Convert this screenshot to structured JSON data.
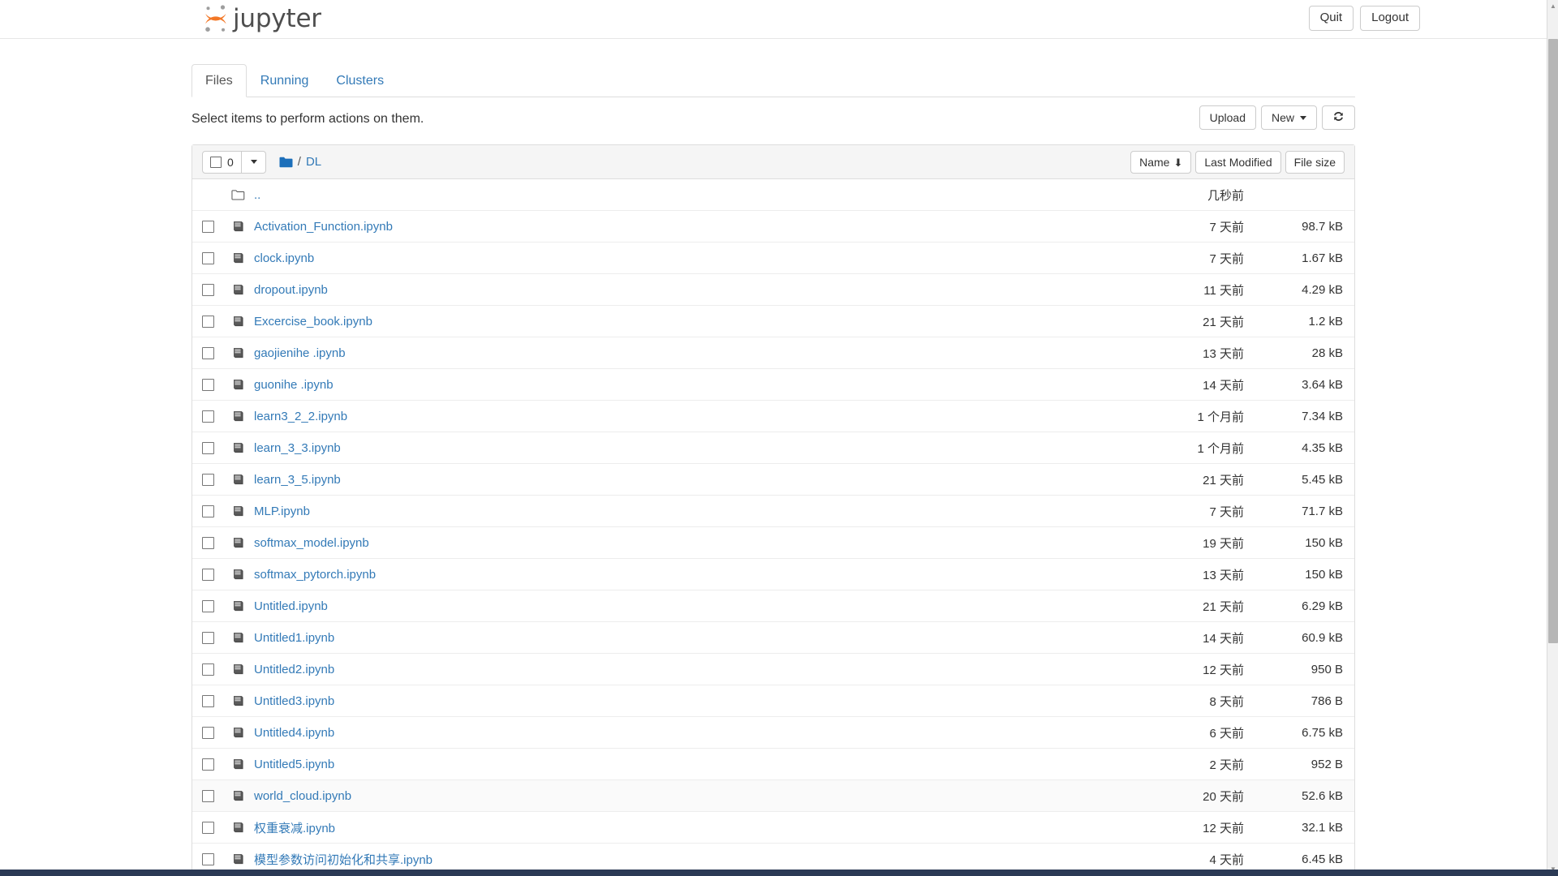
{
  "header": {
    "logo_text": "jupyter",
    "logo_icon": "jupyter-logo-icon",
    "quit_label": "Quit",
    "logout_label": "Logout"
  },
  "tabs": [
    {
      "label": "Files",
      "active": true
    },
    {
      "label": "Running",
      "active": false
    },
    {
      "label": "Clusters",
      "active": false
    }
  ],
  "actions": {
    "note": "Select items to perform actions on them.",
    "upload_label": "Upload",
    "new_label": "New",
    "refresh_icon": "refresh-icon"
  },
  "list_toolbar": {
    "selected_count": "0",
    "folder_icon": "folder-icon",
    "breadcrumb_separator": "/",
    "breadcrumb_current": "DL",
    "sort_name": "Name",
    "sort_name_arrow": "⬇",
    "sort_last_modified": "Last Modified",
    "sort_file_size": "File size"
  },
  "files": [
    {
      "name": "..",
      "icon": "folder-icon",
      "date": "几秒前",
      "size": "",
      "checkbox": false
    },
    {
      "name": "Activation_Function.ipynb",
      "icon": "notebook-icon",
      "date": "7 天前",
      "size": "98.7 kB",
      "checkbox": true
    },
    {
      "name": "clock.ipynb",
      "icon": "notebook-icon",
      "date": "7 天前",
      "size": "1.67 kB",
      "checkbox": true
    },
    {
      "name": "dropout.ipynb",
      "icon": "notebook-icon",
      "date": "11 天前",
      "size": "4.29 kB",
      "checkbox": true
    },
    {
      "name": "Excercise_book.ipynb",
      "icon": "notebook-icon",
      "date": "21 天前",
      "size": "1.2 kB",
      "checkbox": true
    },
    {
      "name": "gaojienihe .ipynb",
      "icon": "notebook-icon",
      "date": "13 天前",
      "size": "28 kB",
      "checkbox": true
    },
    {
      "name": "guonihe .ipynb",
      "icon": "notebook-icon",
      "date": "14 天前",
      "size": "3.64 kB",
      "checkbox": true
    },
    {
      "name": "learn3_2_2.ipynb",
      "icon": "notebook-icon",
      "date": "1 个月前",
      "size": "7.34 kB",
      "checkbox": true
    },
    {
      "name": "learn_3_3.ipynb",
      "icon": "notebook-icon",
      "date": "1 个月前",
      "size": "4.35 kB",
      "checkbox": true
    },
    {
      "name": "learn_3_5.ipynb",
      "icon": "notebook-icon",
      "date": "21 天前",
      "size": "5.45 kB",
      "checkbox": true
    },
    {
      "name": "MLP.ipynb",
      "icon": "notebook-icon",
      "date": "7 天前",
      "size": "71.7 kB",
      "checkbox": true
    },
    {
      "name": "softmax_model.ipynb",
      "icon": "notebook-icon",
      "date": "19 天前",
      "size": "150 kB",
      "checkbox": true
    },
    {
      "name": "softmax_pytorch.ipynb",
      "icon": "notebook-icon",
      "date": "13 天前",
      "size": "150 kB",
      "checkbox": true
    },
    {
      "name": "Untitled.ipynb",
      "icon": "notebook-icon",
      "date": "21 天前",
      "size": "6.29 kB",
      "checkbox": true
    },
    {
      "name": "Untitled1.ipynb",
      "icon": "notebook-icon",
      "date": "14 天前",
      "size": "60.9 kB",
      "checkbox": true
    },
    {
      "name": "Untitled2.ipynb",
      "icon": "notebook-icon",
      "date": "12 天前",
      "size": "950 B",
      "checkbox": true
    },
    {
      "name": "Untitled3.ipynb",
      "icon": "notebook-icon",
      "date": "8 天前",
      "size": "786 B",
      "checkbox": true
    },
    {
      "name": "Untitled4.ipynb",
      "icon": "notebook-icon",
      "date": "6 天前",
      "size": "6.75 kB",
      "checkbox": true
    },
    {
      "name": "Untitled5.ipynb",
      "icon": "notebook-icon",
      "date": "2 天前",
      "size": "952 B",
      "checkbox": true
    },
    {
      "name": "world_cloud.ipynb",
      "icon": "notebook-icon",
      "date": "20 天前",
      "size": "52.6 kB",
      "checkbox": true
    },
    {
      "name": "权重衰减.ipynb",
      "icon": "notebook-icon",
      "date": "12 天前",
      "size": "32.1 kB",
      "checkbox": true
    },
    {
      "name": "模型参数访问初始化和共享.ipynb",
      "icon": "notebook-icon",
      "date": "4 天前",
      "size": "6.45 kB",
      "checkbox": true
    }
  ],
  "colors": {
    "link": "#337ab7",
    "logo_orange": "#f37726",
    "logo_gray": "#9e9e9e",
    "folder_blue": "#1c6fba",
    "toolbar_bg": "#f5f5f5"
  },
  "scrollbars": {
    "vertical_up_arrow": "▲",
    "vertical_down_arrow": "▼"
  }
}
